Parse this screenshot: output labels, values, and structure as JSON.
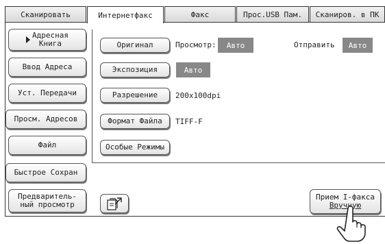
{
  "tabs": [
    "Сканировать",
    "Интернетфакс",
    "Факс",
    "Прос.USB Пам.",
    "Сканиров. в ПК"
  ],
  "sidebar": {
    "address_book_line1": "Адресная",
    "address_book_line2": "Книга",
    "address_entry": "Ввод Адреса",
    "send_settings": "Уст. Передачи",
    "address_review": "Просм. Адресов",
    "file": "Файл",
    "quick_save": "Быстрое Сохран",
    "preview_line1": "Предваритель-",
    "preview_line2": "ный просмотр"
  },
  "settings": {
    "original_button": "Оригинал",
    "view_label": "Просмотр:",
    "view_value": "Авто",
    "send_label": "Отправить",
    "send_value": "Авто",
    "exposure_button": "Экспозиция",
    "exposure_value": "Авто",
    "resolution_button": "Разрешение",
    "resolution_value": "200x100dpi",
    "file_format_button": "Формат Файла",
    "file_format_value": "TIFF-F",
    "special_modes_button": "Особые Режимы"
  },
  "bottom": {
    "manual_receive_line1": "Прием I-факса",
    "manual_receive_line2": "Вручную"
  },
  "colors": {
    "badge": "#888888",
    "border": "#333333"
  }
}
